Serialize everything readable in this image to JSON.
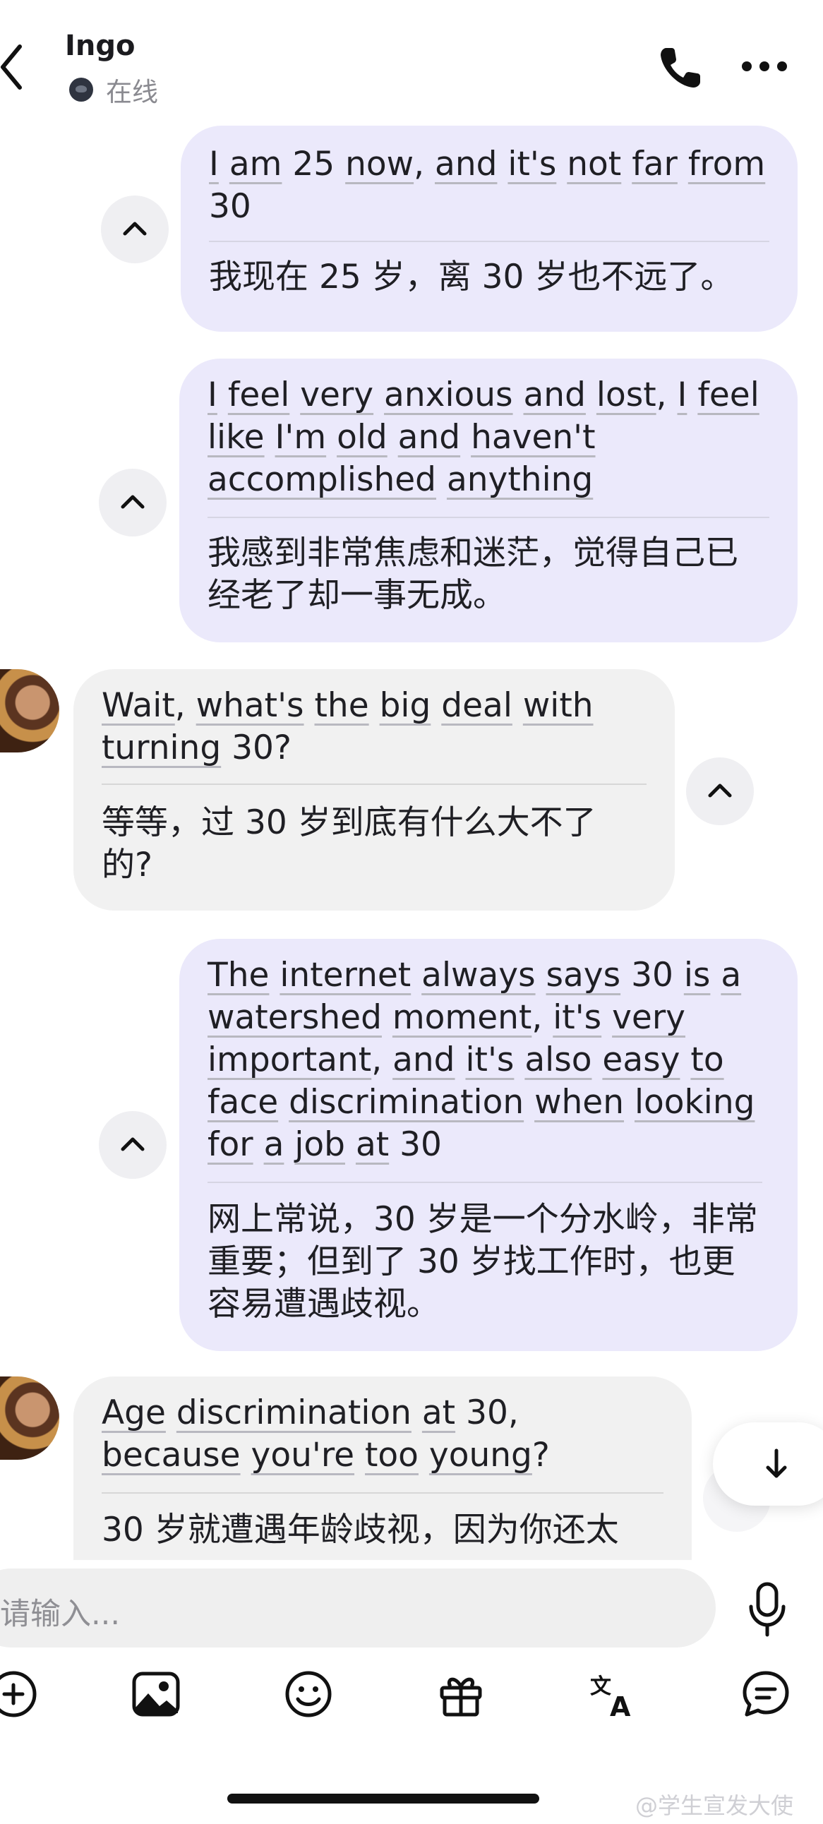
{
  "header": {
    "contact_name": "Ingo",
    "status": "在线"
  },
  "messages": [
    {
      "direction": "out",
      "en_words": [
        "I",
        " ",
        "am",
        " ",
        "25",
        " ",
        "now",
        ", ",
        "and",
        " ",
        "it's",
        " ",
        "not",
        " ",
        "far",
        " ",
        "from",
        " ",
        "30"
      ],
      "zh": "我现在 25 岁，离 30 岁也不远了。"
    },
    {
      "direction": "out",
      "en_words": [
        "I",
        " ",
        "feel",
        " ",
        "very",
        " ",
        "anxious",
        " ",
        "and",
        " ",
        "lost",
        ", ",
        "I",
        " ",
        "feel",
        " ",
        "like",
        " ",
        "I'm",
        " ",
        "old",
        " ",
        "and",
        " ",
        "haven't",
        " ",
        "accomplished",
        " ",
        "anything"
      ],
      "zh": "我感到非常焦虑和迷茫，觉得自己已经老了却一事无成。"
    },
    {
      "direction": "in",
      "en_words": [
        "Wait",
        ", ",
        "what's",
        " ",
        "the",
        " ",
        "big",
        " ",
        "deal",
        " ",
        "with",
        " ",
        "turning",
        " ",
        "30",
        "?"
      ],
      "zh": "等等，过 30 岁到底有什么大不了的?"
    },
    {
      "direction": "out",
      "en_words": [
        "The",
        " ",
        "internet",
        " ",
        "always",
        " ",
        "says",
        " ",
        "30",
        " ",
        "is",
        " ",
        "a",
        " ",
        "watershed",
        " ",
        "moment",
        ", ",
        "it's",
        " ",
        "very",
        " ",
        "important",
        ", ",
        "and",
        " ",
        "it's",
        " ",
        "also",
        " ",
        "easy",
        " ",
        "to",
        " ",
        "face",
        " ",
        "discrimination",
        " ",
        "when",
        " ",
        "looking",
        " ",
        "for",
        " ",
        "a",
        " ",
        "job",
        " ",
        "at",
        " ",
        "30"
      ],
      "zh": "网上常说，30 岁是一个分水岭，非常重要；但到了 30 岁找工作时，也更容易遭遇歧视。"
    },
    {
      "direction": "in",
      "en_words": [
        "Age",
        " ",
        "discrimination",
        " ",
        "at",
        " ",
        "30",
        ", ",
        "because",
        " ",
        "you're",
        " ",
        "too",
        " ",
        "young",
        "?"
      ],
      "zh": "30 岁就遭遇年龄歧视，因为你还太"
    }
  ],
  "composer": {
    "placeholder": "请输入..."
  },
  "toolbar": {
    "icons": [
      "add-icon",
      "image-icon",
      "emoji-icon",
      "gift-icon",
      "translate-icon",
      "chat-bubble-icon"
    ]
  },
  "watermark": "@学生宣发大使"
}
